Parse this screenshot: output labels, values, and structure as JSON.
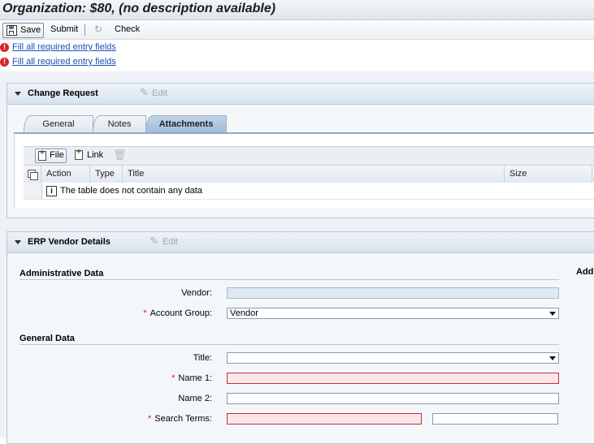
{
  "title": "Organization: $80, (no description available)",
  "toolbar": {
    "save_label": "Save",
    "submit_label": "Submit",
    "check_label": "Check"
  },
  "messages": [
    {
      "icon": "error-icon",
      "text": "Fill all required entry fields"
    },
    {
      "icon": "error-icon",
      "text": "Fill all required entry fields"
    }
  ],
  "change_request": {
    "title": "Change Request",
    "edit_label": "Edit",
    "tabs": [
      "General",
      "Notes",
      "Attachments"
    ],
    "active_tab": "Attachments",
    "attachments": {
      "file_label": "File",
      "link_label": "Link",
      "columns": [
        "Action",
        "Type",
        "Title",
        "Size"
      ],
      "empty_text": "The table does not contain any data"
    }
  },
  "erp_vendor": {
    "title": "ERP Vendor Details",
    "edit_label": "Edit",
    "right_section_partial": "Add",
    "admin_section": "Administrative Data",
    "general_section": "General Data",
    "fields": {
      "vendor_label": "Vendor:",
      "vendor_value": "",
      "account_group_label": "Account Group:",
      "account_group_value": "Vendor",
      "title_label": "Title:",
      "title_value": "",
      "name1_label": "Name 1:",
      "name1_value": "",
      "name2_label": "Name 2:",
      "name2_value": "",
      "search_terms_label": "Search Terms:",
      "search_terms_value": "",
      "search_terms_2_value": ""
    },
    "required_marker": "*"
  },
  "colors": {
    "error": "#d6242b",
    "link": "#1a4fb7",
    "error_field_bg": "#fbe5e8",
    "active_tab": "#a9c3de"
  }
}
